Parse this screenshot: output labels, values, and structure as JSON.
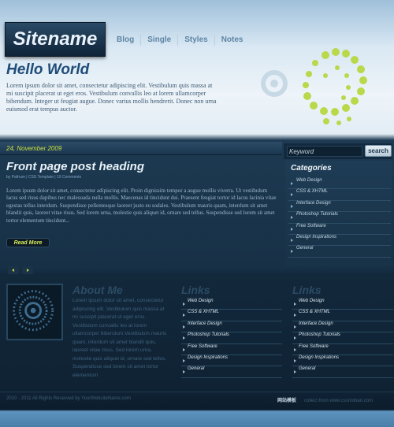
{
  "header": {
    "logo": "Sitename",
    "nav": [
      "Blog",
      "Single",
      "Styles",
      "Notes"
    ]
  },
  "intro": {
    "title": "Hello World",
    "text": "Lorem ipsum dolor sit amet, consectetur adipiscing elit. Vestibulum quis massa at mi suscipit placerat ut eget eros. Vestibulum convallis leo at lorem ullamcorper bibendum. Integer ut feugiat augue. Donec varius mollis hendrerit. Donec non urna euismod erat tempus auctor."
  },
  "post": {
    "date": "24, November 2009",
    "heading": "Front page post heading",
    "meta": "by Pathum | CSS Template | 10 Comments",
    "body": "Lorem ipsum dolor sit amet, consectetur adipiscing elit. Proin dignissim tempor a augue mollis viverra. Ut vestibulum lacus sed risus dapibus nec malesuada nulla mollis. Maecenas id tincidunt dui. Praesent feugiat tortor id lacus lacinia vitae egestas tellus interdum. Suspendisse pellentesque laoreet justo eu sodales. Vestibulum mauris quam, interdum sit amet blandit quis, laoreet vitae risus. Sed lorem urna, molestie quis aliquet id, ornare sed tellus. Suspendisse sed lorem sit amet tortor elementum tincidunt...",
    "read_more": "Read More"
  },
  "search": {
    "placeholder": "Keyword",
    "button": "search"
  },
  "categories": {
    "title": "Categories",
    "items": [
      "Web Design",
      "CSS & XHTML",
      "Interface Design",
      "Photoshop Tutorials",
      "Free Software",
      "Design Inspirations",
      "General"
    ]
  },
  "about": {
    "title": "About Me",
    "text": "Lorem ipsum dolor sit amet, consectetur adipiscing elit. Vestibulum quis massa at mi suscipit placerat ut eget eros. Vestibulum convallis leo at lorem ullamcorper bibendum.Vestibulum mauris quam, interdum sit amet blandit quis, laoreet vitae risus. Sed lorem urna, molestie quis aliquet id, ornare sed tellus. Suspendisse sed lorem sit amet tortor elementum"
  },
  "links1": {
    "title": "Links",
    "items": [
      "Web Design",
      "CSS & XHTML",
      "Interface Design",
      "Photoshop Tutorials",
      "Free Software",
      "Design Inspirations",
      "General"
    ]
  },
  "links2": {
    "title": "Links",
    "items": [
      "Web Design",
      "CSS & XHTML",
      "Interface Design",
      "Photoshop Tutorials",
      "Free Software",
      "Design Inspirations",
      "General"
    ]
  },
  "footer": {
    "copyright": "2010 - 2011 All Rights Reserved by YourWebsiteName.com",
    "brand": "网站模板",
    "credit": "collect from www.cssmoban.com"
  },
  "colors": {
    "accent_green": "#c9e23c",
    "heading_blue": "#1f4c78"
  }
}
